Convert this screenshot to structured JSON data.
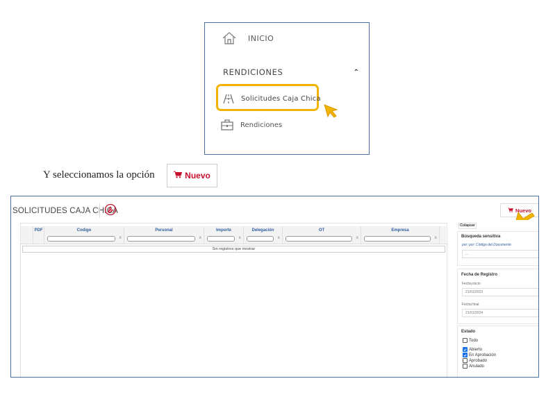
{
  "menu": {
    "home_label": "INICIO",
    "section_label": "RENDICIONES",
    "items": [
      {
        "label": "Solicitudes Caja Chica",
        "highlighted": true
      },
      {
        "label": "Rendiciones",
        "highlighted": false
      }
    ]
  },
  "instruction": {
    "text": "Y seleccionamos la opción",
    "button_label": "Nuevo"
  },
  "app": {
    "title": "SOLICITUDES CAJA CHICA",
    "new_button_label": "Nuevo",
    "grid": {
      "columns": [
        "PDF",
        "Codigo",
        "Personal",
        "Importe",
        "Delegación",
        "OT",
        "Empresa"
      ],
      "clear_glyph": "x",
      "empty_message": "Sin registros que mostrar"
    },
    "filters": {
      "collapse_label": "Colapsar",
      "search": {
        "title": "Búsqueda sensitiva",
        "hint": "por: por: Código del Documento",
        "value": "..."
      },
      "date": {
        "title": "Fecha de Registro",
        "start_label": "Fecha inicio",
        "start_value": "21/01/2023",
        "end_label": "Fecha final",
        "end_value": "21/01/2024"
      },
      "status": {
        "title": "Estado",
        "options": [
          {
            "label": "Todo",
            "checked": false
          },
          {
            "label": "Abierto",
            "checked": true
          },
          {
            "label": "En Aprobación",
            "checked": true
          },
          {
            "label": "Aprobado",
            "checked": false
          },
          {
            "label": "Anulado",
            "checked": false
          }
        ]
      }
    }
  },
  "colors": {
    "highlight": "#f2b400",
    "accent_red": "#c8102e",
    "header_blue": "#2e5d9b",
    "frame_border": "#4a6fa5"
  },
  "icons": {
    "home": "home-icon",
    "chevron": "chevron-up-icon",
    "solicitudes": "road-icon",
    "rendiciones": "briefcase-icon",
    "cart": "cart-icon",
    "pdf": "pdf-icon",
    "cursor": "cursor-arrow-icon"
  }
}
